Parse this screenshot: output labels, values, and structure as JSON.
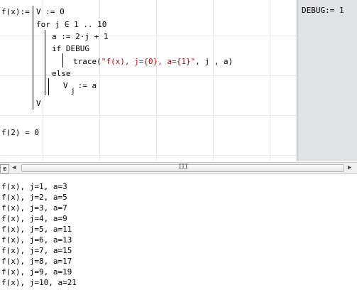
{
  "worksheet": {
    "fname": "f(x):=",
    "line_init": "V := 0",
    "line_for": "for j ∈ 1 .. 10",
    "line_assign": "a := 2·j + 1",
    "line_if": "if DEBUG",
    "trace_prefix": "trace(",
    "trace_string": "\"f(x), j={0}, a={1}\"",
    "trace_args": ", j , a)",
    "line_else": "else",
    "line_vassign_v": "V",
    "line_vassign_sub": "j",
    "line_vassign_rest": ":= a",
    "line_return": "V",
    "eval": "f(2) = 0",
    "side_def": "DEBUG:= 1"
  },
  "scrollbar": {
    "grip": "III",
    "left_arrow": "◀",
    "right_arrow": "▶",
    "split": "⊞"
  },
  "trace_output": [
    "f(x), j=1, a=3",
    "f(x), j=2, a=5",
    "f(x), j=3, a=7",
    "f(x), j=4, a=9",
    "f(x), j=5, a=11",
    "f(x), j=6, a=13",
    "f(x), j=7, a=15",
    "f(x), j=8, a=17",
    "f(x), j=9, a=19",
    "f(x), j=10, a=21"
  ]
}
